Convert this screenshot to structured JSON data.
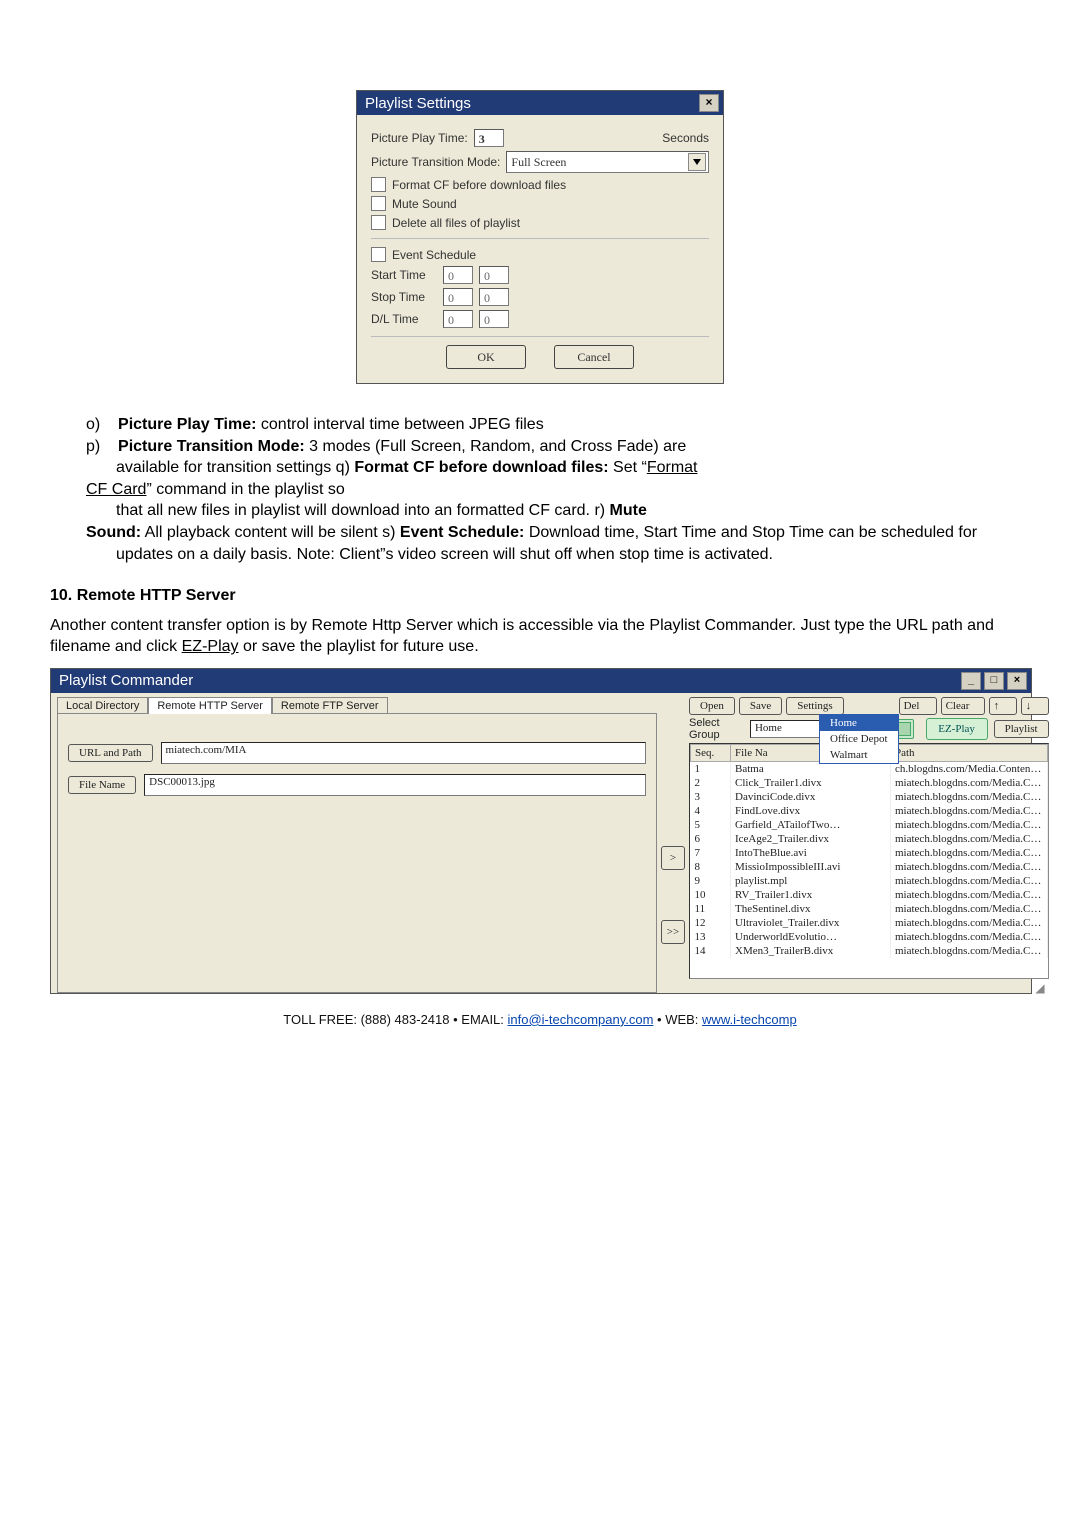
{
  "dlg1": {
    "title": "Playlist Settings",
    "picture_play_time_label": "Picture Play Time:",
    "picture_play_time_value": "3",
    "seconds": "Seconds",
    "transition_mode_label": "Picture Transition Mode:",
    "transition_mode_value": "Full Screen",
    "cb_format_cf": "Format CF before download files",
    "cb_mute": "Mute Sound",
    "cb_delete": "Delete all files of playlist",
    "cb_event": "Event Schedule",
    "start_time_label": "Start Time",
    "stop_time_label": "Stop Time",
    "dl_time_label": "D/L Time",
    "zero": "0",
    "ok": "OK",
    "cancel": "Cancel"
  },
  "doc": {
    "o": "o)",
    "o_text1": "Picture Play Time:",
    "o_text2": " control interval time between JPEG files",
    "p": "p)",
    "p_text1": "Picture Transition Mode:",
    "p_text2": " 3 modes (Full Screen, Random, and Cross Fade) are",
    "p_line2": "available for transition settings q)    ",
    "p_bold3": "Format CF before download files:",
    "p_text3": " Set “",
    "p_link": "Format",
    "cf_line": "CF Card",
    "cf_tail": "” command in the playlist so",
    "r_line": "that all new files in playlist will download into an formatted CF card. r)    ",
    "r_bold": "Mute",
    "sound_bold": "Sound:",
    "sound_text": " All playback content will be silent s)    ",
    "es_bold": "Event Schedule:",
    "es_text": " Download time, Start Time and Stop Time can be scheduled for",
    "update_line": "updates on a daily basis. Note: Client”s video screen will shut off when stop time is activated.",
    "sec10": "10. Remote HTTP Server",
    "para10": "Another content transfer option is by Remote Http Server which is accessible via the Playlist Commander. Just type the URL path and filename and click ",
    "ezplay": "EZ-Play",
    "para10b": " or save the playlist for future use."
  },
  "pc": {
    "title": "Playlist Commander",
    "tabs": {
      "local": "Local Directory",
      "http": "Remote HTTP Server",
      "ftp": "Remote FTP Server"
    },
    "url_btn": "URL and Path",
    "url_val": "miatech.com/MIA",
    "file_btn": "File Name",
    "file_val": "DSC00013.jpg",
    "open": "Open",
    "save": "Save",
    "settings": "Settings",
    "del": "Del",
    "clear": "Clear",
    "up_icon": "↑",
    "down_icon": "↓",
    "selgroup": "Select Group",
    "group_val": "Home",
    "ezplay": "EZ-Play",
    "playlist": "Playlist",
    "menu": {
      "top": "Home",
      "m1": "Office Depot",
      "m2": "Walmart"
    },
    "cols": {
      "seq": "Seq.",
      "name": "File Na",
      "path": "Path"
    },
    "first_path": "ch.blogdns.com/Media.Contents…",
    "other_path": "miatech.blogdns.com/Media.Contents…",
    "rows": [
      {
        "seq": "1",
        "name": "Batma"
      },
      {
        "seq": "2",
        "name": "Click_Trailer1.divx"
      },
      {
        "seq": "3",
        "name": "DavinciCode.divx"
      },
      {
        "seq": "4",
        "name": "FindLove.divx"
      },
      {
        "seq": "5",
        "name": "Garfield_ATailofTwo…"
      },
      {
        "seq": "6",
        "name": "IceAge2_Trailer.divx"
      },
      {
        "seq": "7",
        "name": "IntoTheBlue.avi"
      },
      {
        "seq": "8",
        "name": "MissioImpossibleIII.avi"
      },
      {
        "seq": "9",
        "name": "playlist.mpl"
      },
      {
        "seq": "10",
        "name": "RV_Trailer1.divx"
      },
      {
        "seq": "11",
        "name": "TheSentinel.divx"
      },
      {
        "seq": "12",
        "name": "Ultraviolet_Trailer.divx"
      },
      {
        "seq": "13",
        "name": "UnderworldEvolutio…"
      },
      {
        "seq": "14",
        "name": "XMen3_TrailerB.divx"
      }
    ],
    "add": ">",
    "addall": ">>"
  },
  "footer": {
    "pre": "TOLL FREE: (888) 483-2418 • EMAIL: ",
    "email": "info@i-techcompany.com",
    "mid": " • WEB: ",
    "web": "www.i-techcomp"
  }
}
